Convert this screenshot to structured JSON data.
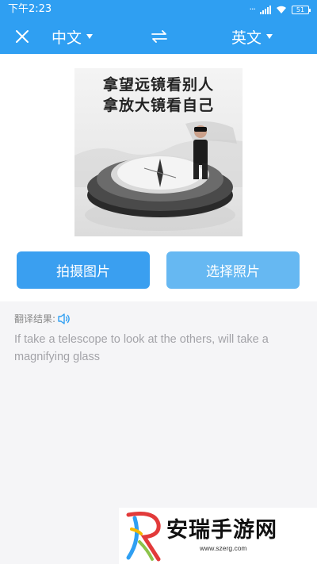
{
  "status_bar": {
    "time": "下午2:23",
    "battery": "51"
  },
  "toolbar": {
    "source_language": "中文",
    "target_language": "英文",
    "close_icon": "close-icon",
    "swap_icon": "swap-arrows-icon"
  },
  "image": {
    "caption_line1": "拿望远镜看别人",
    "caption_line2": "拿放大镜看自己"
  },
  "actions": {
    "take_photo_label": "拍摄图片",
    "choose_photo_label": "选择照片"
  },
  "result": {
    "label": "翻译结果:",
    "speaker_icon": "speaker-icon",
    "text": "If take a telescope to look at the others, will take a magnifying glass"
  },
  "watermark": {
    "title": "安瑞手游网",
    "url": "www.szerg.com"
  },
  "colors": {
    "primary": "#2f9ff2",
    "button_primary": "#3a9ff0",
    "button_secondary": "#66b8f2",
    "result_text": "#a3a3a8",
    "background": "#f5f5f7"
  }
}
